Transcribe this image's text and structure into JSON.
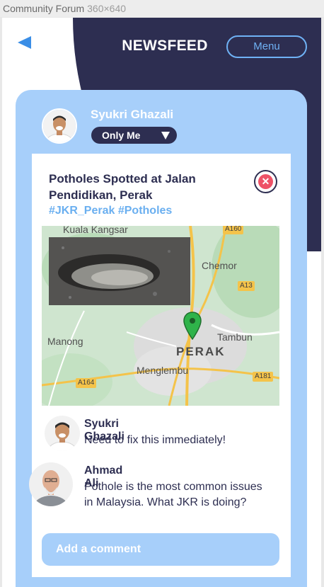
{
  "window": {
    "title": "Community Forum",
    "dimensions": "360×640"
  },
  "header": {
    "title": "NEWSFEED",
    "menu_label": "Menu"
  },
  "post": {
    "author": "Syukri Ghazali",
    "privacy": "Only Me",
    "title": "Potholes Spotted at Jalan Pendidikan, Perak",
    "hashtags": [
      "#JKR_Perak",
      "#Potholes"
    ],
    "map": {
      "places": [
        "Kuala Kangsar",
        "Chemor",
        "Manong",
        "PERAK",
        "Tambun",
        "Menglembu"
      ],
      "roads": [
        "A160",
        "A13",
        "A164",
        "A181"
      ]
    }
  },
  "comments": [
    {
      "name": "Syukri Ghazali",
      "text": "Need to fix this immediately!"
    },
    {
      "name": "Ahmad Ali",
      "text": "Pothole is the most common issues in Malaysia. What JKR is doing?"
    }
  ],
  "add_comment": {
    "placeholder": "Add a comment"
  },
  "colors": {
    "navy": "#2d2e51",
    "accent_blue": "#6aaff0",
    "card_blue": "#a7cffa",
    "close_red": "#ee5267",
    "pin_green": "#2fb34a"
  }
}
